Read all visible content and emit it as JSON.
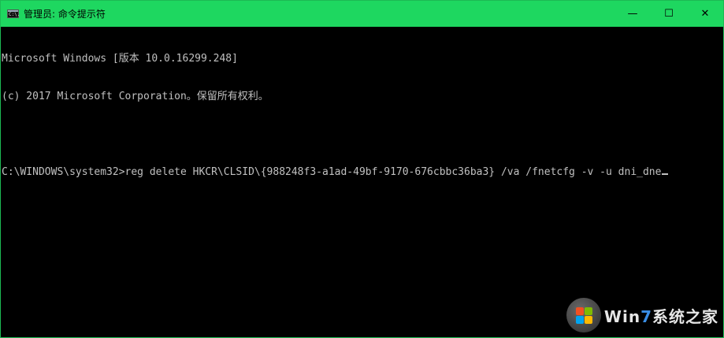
{
  "window": {
    "title": "管理员: 命令提示符",
    "icon_label": "C:\\.",
    "controls": {
      "minimize": "—",
      "maximize": "☐",
      "close": "✕"
    }
  },
  "console": {
    "lines": [
      "Microsoft Windows [版本 10.0.16299.248]",
      "(c) 2017 Microsoft Corporation。保留所有权利。",
      "",
      "C:\\WINDOWS\\system32>reg delete HKCR\\CLSID\\{988248f3-a1ad-49bf-9170-676cbbc36ba3} /va /fnetcfg -v -u dni_dne"
    ]
  },
  "watermark": {
    "brand_win": "Win",
    "brand_seven": "7",
    "brand_rest": "系统之家"
  }
}
